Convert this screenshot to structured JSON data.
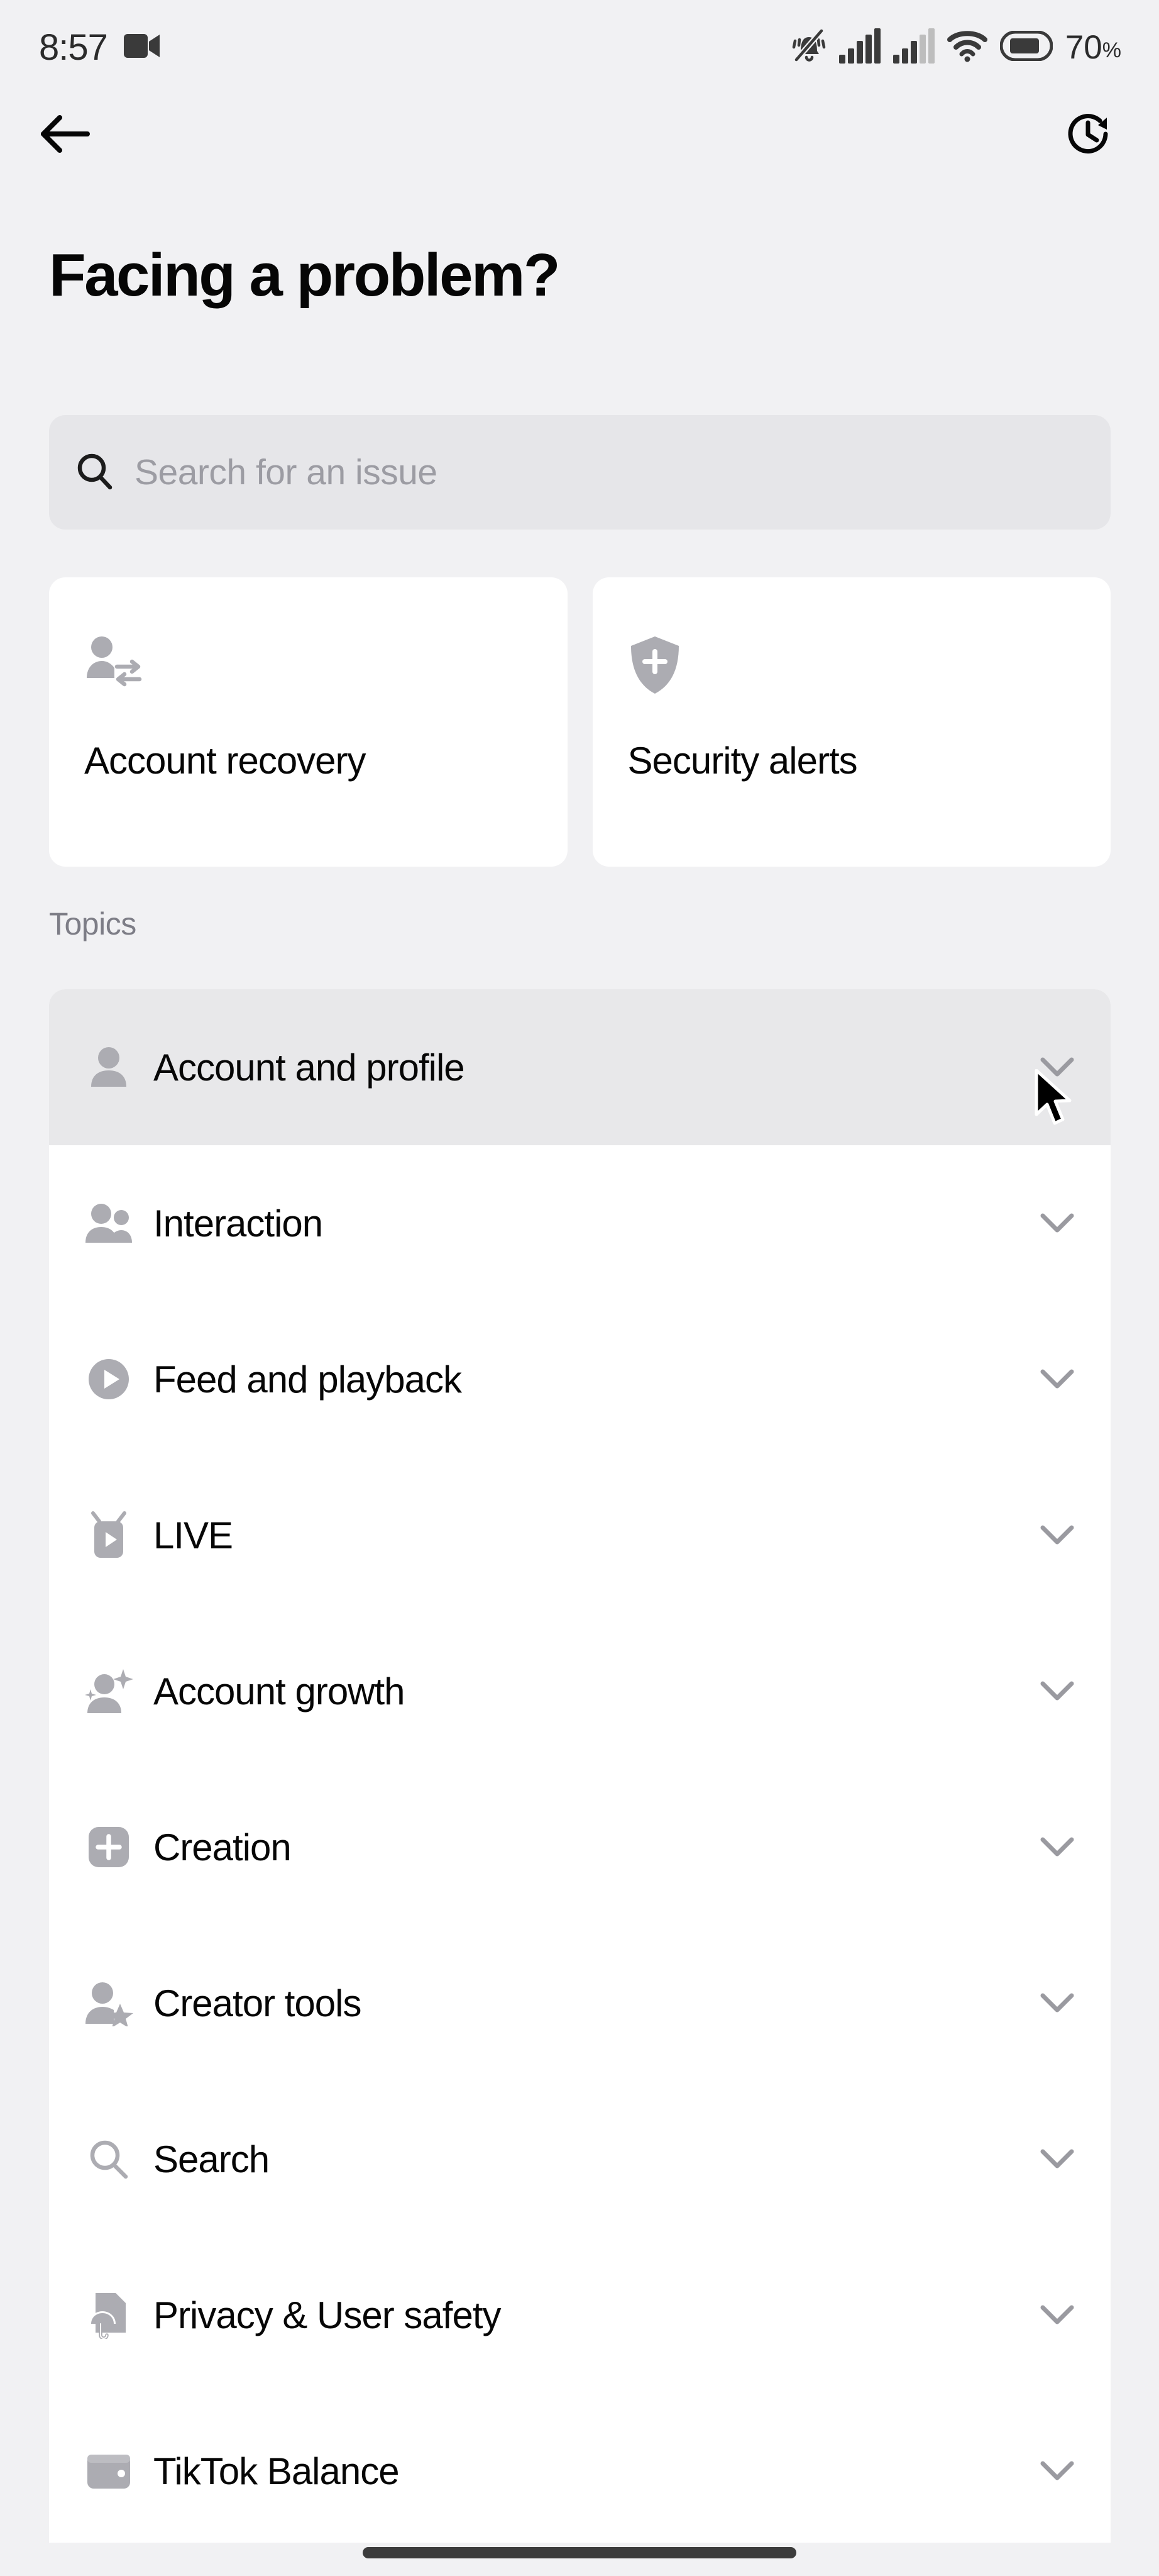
{
  "status_bar": {
    "time": "8:57",
    "battery_percent": "70",
    "battery_unit": "%",
    "icons": [
      "screen-record-icon",
      "silent-vibrate-icon",
      "signal-bars-icon",
      "signal-bars-secondary-icon",
      "wifi-icon",
      "battery-icon"
    ]
  },
  "nav": {
    "back_icon": "back-arrow-icon",
    "history_icon": "history-clock-icon"
  },
  "header": {
    "title": "Facing a problem?"
  },
  "search": {
    "placeholder": "Search for an issue",
    "icon": "search-icon"
  },
  "quick_cards": [
    {
      "label": "Account recovery",
      "icon": "account-switch-icon"
    },
    {
      "label": "Security alerts",
      "icon": "shield-plus-icon"
    }
  ],
  "topics": {
    "section_label": "Topics",
    "items": [
      {
        "label": "Account and profile",
        "icon": "person-icon",
        "pressed": true,
        "chevron": "chevron-down-icon"
      },
      {
        "label": "Interaction",
        "icon": "people-icon",
        "pressed": false,
        "chevron": "chevron-down-icon"
      },
      {
        "label": "Feed and playback",
        "icon": "play-circle-icon",
        "pressed": false,
        "chevron": "chevron-down-icon"
      },
      {
        "label": "LIVE",
        "icon": "live-broadcast-icon",
        "pressed": false,
        "chevron": "chevron-down-icon"
      },
      {
        "label": "Account growth",
        "icon": "person-sparkle-icon",
        "pressed": false,
        "chevron": "chevron-down-icon"
      },
      {
        "label": "Creation",
        "icon": "plus-square-icon",
        "pressed": false,
        "chevron": "chevron-down-icon"
      },
      {
        "label": "Creator tools",
        "icon": "person-star-icon",
        "pressed": false,
        "chevron": "chevron-down-icon"
      },
      {
        "label": "Search",
        "icon": "search-icon",
        "pressed": false,
        "chevron": "chevron-down-icon"
      },
      {
        "label": "Privacy & User safety",
        "icon": "document-umbrella-icon",
        "pressed": false,
        "chevron": "chevron-down-icon"
      },
      {
        "label": "TikTok Balance",
        "icon": "wallet-icon",
        "pressed": false,
        "chevron": "chevron-down-icon"
      }
    ]
  },
  "colors": {
    "background": "#F1F1F3",
    "card": "#FFFFFF",
    "pressed_row": "#E8E8EA",
    "search_field": "#E6E6E9",
    "text_primary": "#060606",
    "text_secondary": "#7D7D86",
    "icon_gray": "#ACACB2",
    "placeholder": "#9C9CA3"
  },
  "system": {
    "home_indicator": "home-indicator",
    "cursor": "mouse-cursor"
  }
}
